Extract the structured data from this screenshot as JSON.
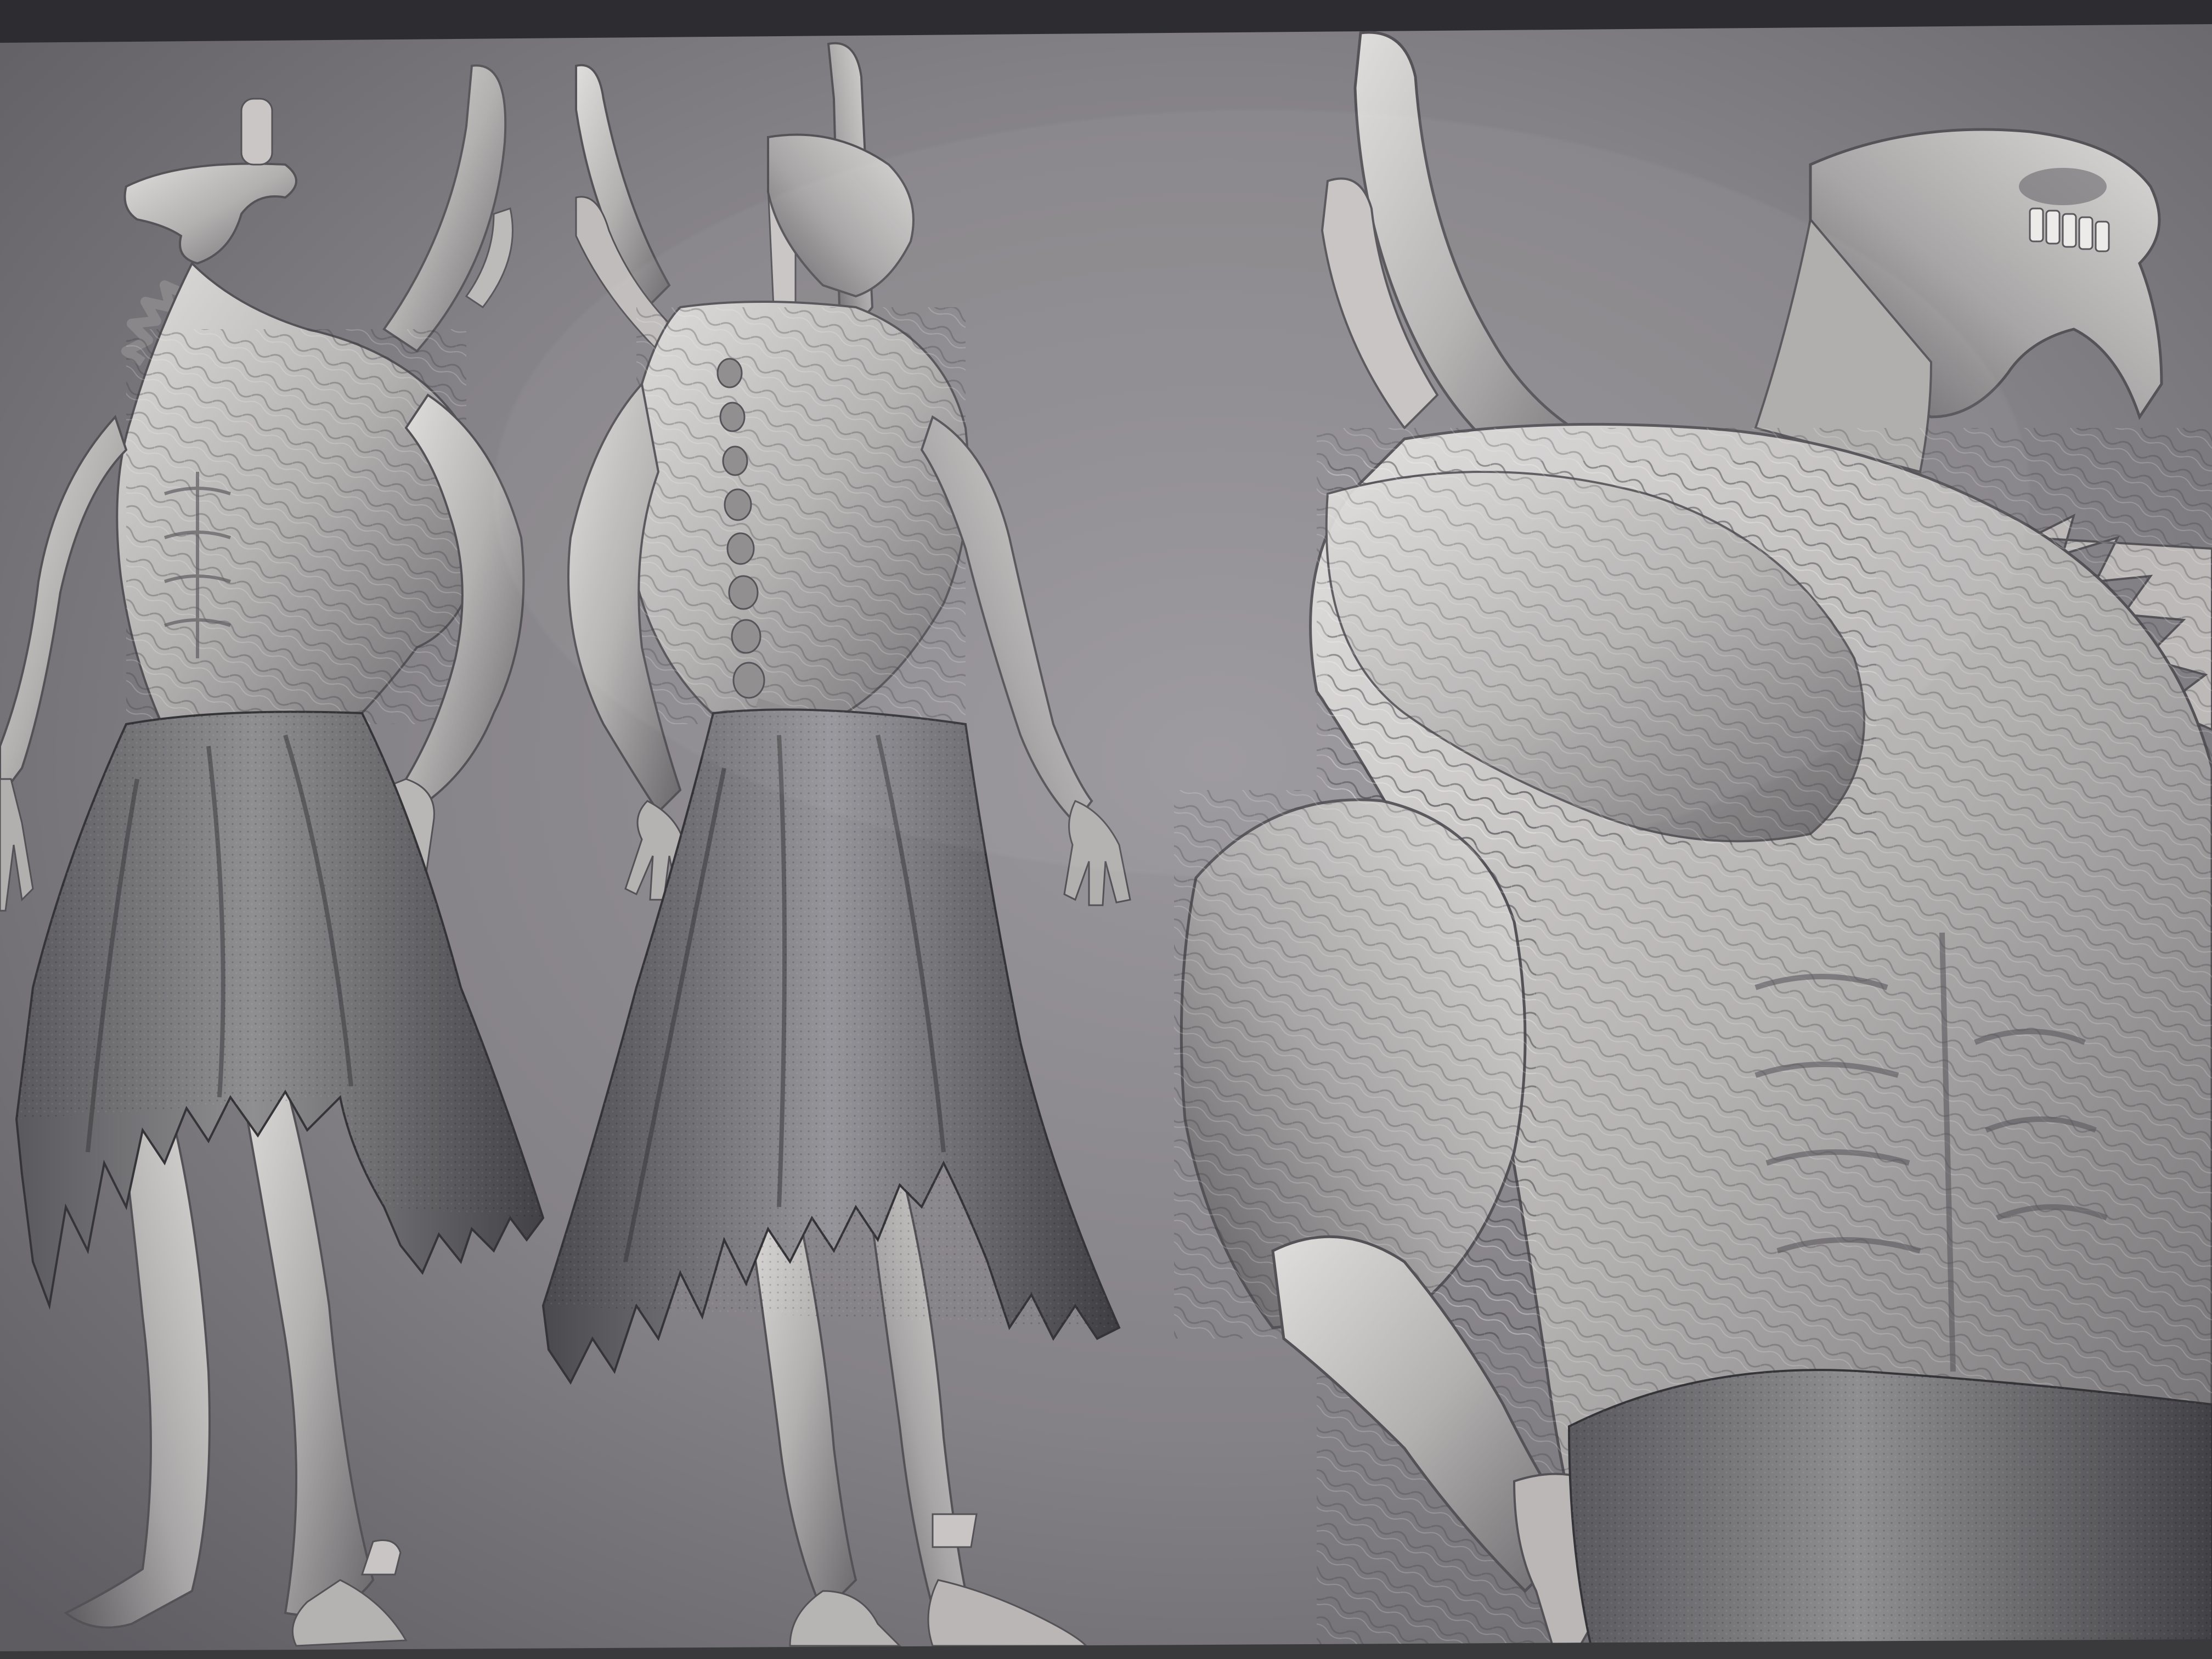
{
  "photo": {
    "subject": "",
    "colors": {
      "bezel_top": "#2e2d31",
      "bezel_bottom": "#3a393c",
      "screen_center": "#8d8a90",
      "screen_edge": "#5e5c61",
      "clay_light": "#d8d6d4",
      "clay_mid": "#a9a6a6",
      "clay_dark": "#5f5d60",
      "cloth_light": "#8e8d8f",
      "cloth_dark": "#3f3e42"
    },
    "figures": [
      {
        "name": "figure-front-three-quarter"
      },
      {
        "name": "figure-back-three-quarter"
      },
      {
        "name": "figure-torso-closeup"
      }
    ]
  }
}
